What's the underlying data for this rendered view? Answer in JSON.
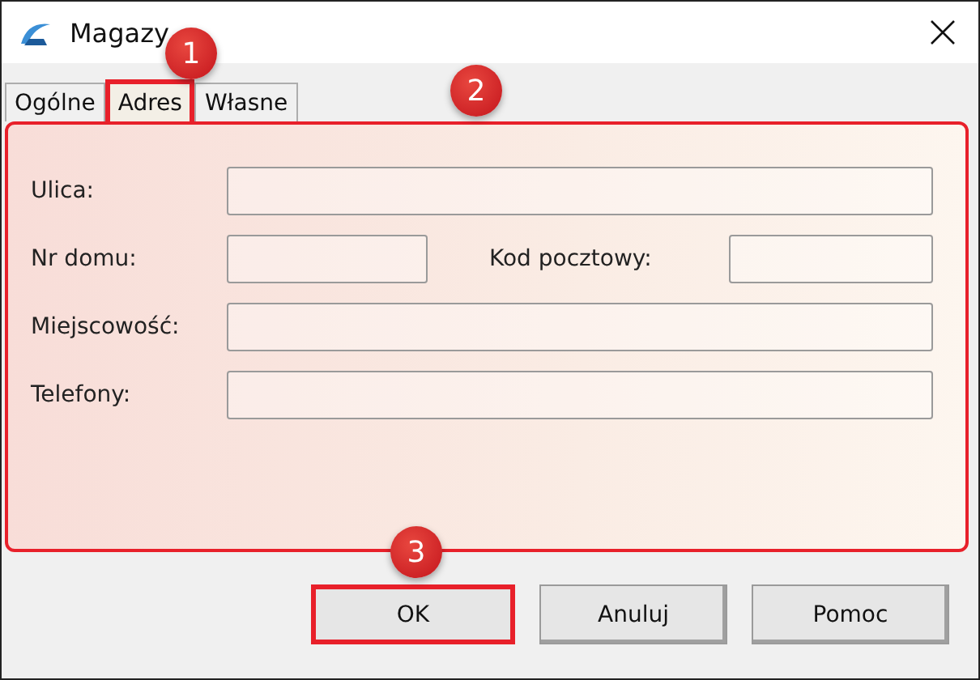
{
  "window": {
    "title": "Magazy"
  },
  "tabs": [
    {
      "label": "Ogólne",
      "selected": false,
      "highlighted": false
    },
    {
      "label": "Adres",
      "selected": true,
      "highlighted": true
    },
    {
      "label": "Własne",
      "selected": false,
      "highlighted": false
    }
  ],
  "panel": {
    "highlighted": true,
    "rows": [
      {
        "kind": "wide",
        "fields": [
          {
            "label": "Ulica:"
          }
        ]
      },
      {
        "kind": "pair",
        "fields": [
          {
            "label": "Nr domu:"
          },
          {
            "label": "Kod pocztowy:"
          }
        ]
      },
      {
        "kind": "wide",
        "fields": [
          {
            "label": "Miejscowość:"
          }
        ]
      },
      {
        "kind": "wide",
        "fields": [
          {
            "label": "Telefony:"
          }
        ]
      }
    ]
  },
  "buttons": [
    {
      "label": "OK",
      "highlighted": true
    },
    {
      "label": "Anuluj",
      "highlighted": false
    },
    {
      "label": "Pomoc",
      "highlighted": false
    }
  ],
  "callouts": [
    {
      "number": "1"
    },
    {
      "number": "2"
    },
    {
      "number": "3"
    }
  ]
}
